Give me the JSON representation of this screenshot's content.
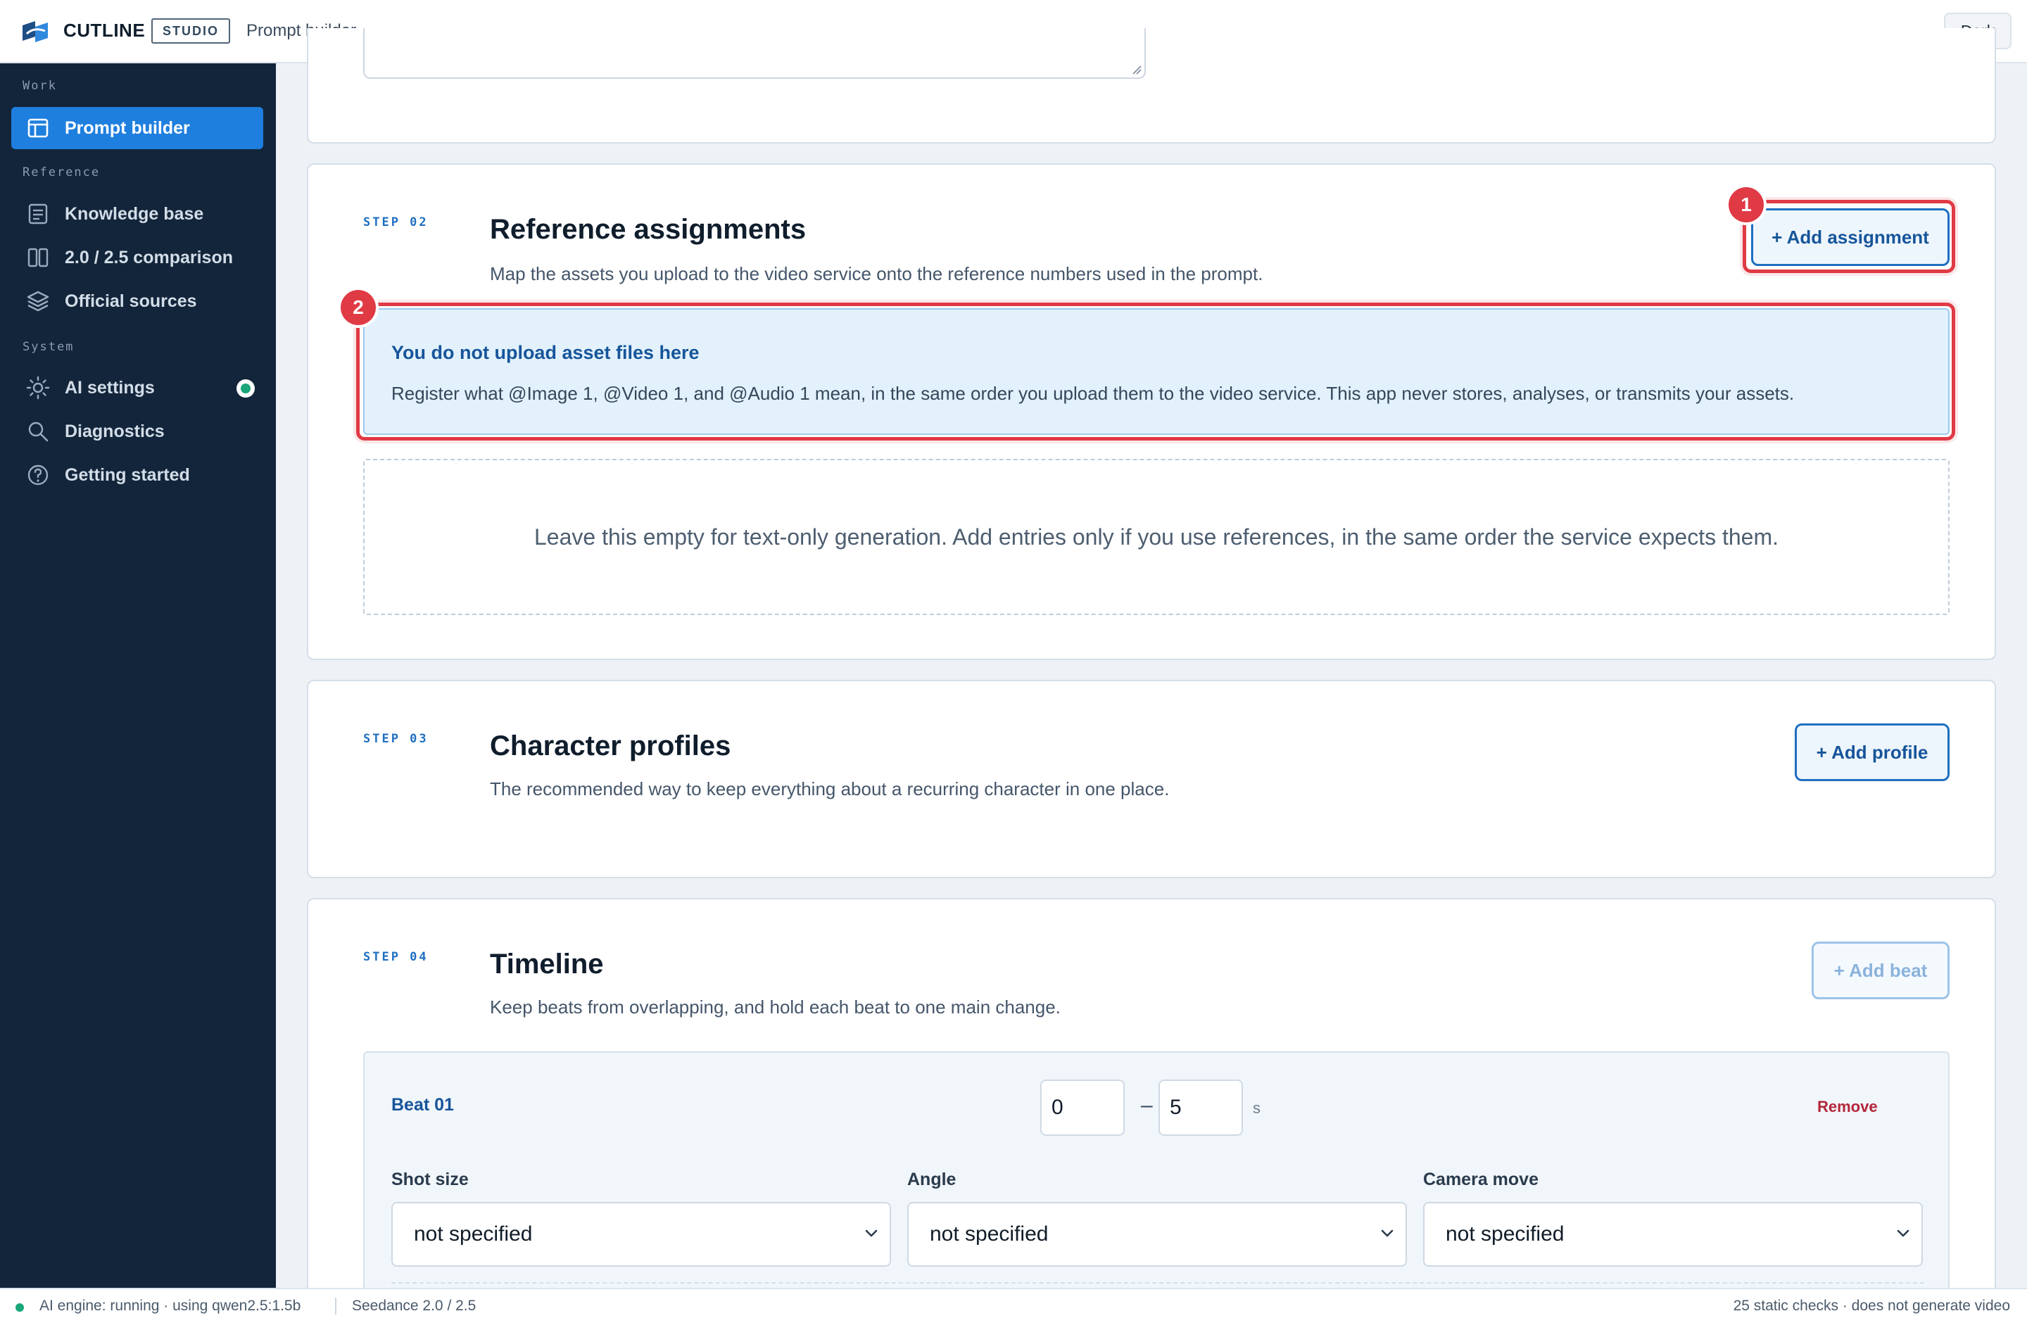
{
  "header": {
    "brand": "CUTLINE",
    "badge": "STUDIO",
    "page": "Prompt builder",
    "theme_button": "Dark"
  },
  "sidebar": {
    "sections": [
      {
        "label": "Work"
      },
      {
        "label": "Reference"
      },
      {
        "label": "System"
      }
    ],
    "items": [
      {
        "label": "Prompt builder",
        "icon": "layout-icon",
        "active": true
      },
      {
        "label": "Knowledge base",
        "icon": "document-icon"
      },
      {
        "label": "2.0 / 2.5 comparison",
        "icon": "columns-icon"
      },
      {
        "label": "Official sources",
        "icon": "layers-icon"
      },
      {
        "label": "AI settings",
        "icon": "sun-icon",
        "status": "running"
      },
      {
        "label": "Diagnostics",
        "icon": "search-icon"
      },
      {
        "label": "Getting started",
        "icon": "help-circle-icon"
      }
    ]
  },
  "steps": {
    "s2": {
      "label": "STEP 02",
      "title": "Reference assignments",
      "desc": "Map the assets you upload to the video service onto the reference numbers used in the prompt.",
      "button": "+ Add assignment",
      "info_title": "You do not upload asset files here",
      "info_text": "Register what @Image 1, @Video 1, and @Audio 1 mean, in the same order you upload them to the video service. This app never stores, analyses, or transmits your assets.",
      "empty_text": "Leave this empty for text-only generation. Add entries only if you use references, in the same order the service expects them."
    },
    "s3": {
      "label": "STEP 03",
      "title": "Character profiles",
      "desc": "The recommended way to keep everything about a recurring character in one place.",
      "button": "+ Add profile"
    },
    "s4": {
      "label": "STEP 04",
      "title": "Timeline",
      "desc": "Keep beats from overlapping, and hold each beat to one main change.",
      "button": "+ Add beat",
      "beat": {
        "title": "Beat 01",
        "start": "0",
        "dash": "–",
        "end": "5",
        "unit": "s",
        "remove": "Remove",
        "fields": [
          {
            "label": "Shot size",
            "value": "not specified"
          },
          {
            "label": "Angle",
            "value": "not specified"
          },
          {
            "label": "Camera move",
            "value": "not specified"
          }
        ]
      }
    }
  },
  "annotations": {
    "m1": "1",
    "m2": "2"
  },
  "statusbar": {
    "engine": "AI engine: running · using qwen2.5:1.5b",
    "version": "Seedance 2.0 / 2.5",
    "checks": "25 static checks · does not generate video"
  },
  "colors": {
    "sidebar_bg": "#13253a",
    "accent": "#1f7fde",
    "highlight": "#e03a45",
    "success": "#1aa57a"
  }
}
